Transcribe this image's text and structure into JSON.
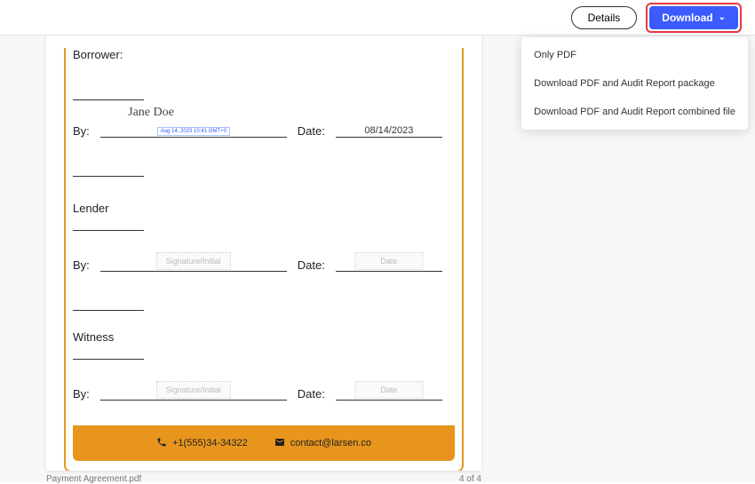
{
  "toolbar": {
    "details_label": "Details",
    "download_label": "Download"
  },
  "download_menu": {
    "items": [
      {
        "label": "Only PDF"
      },
      {
        "label": "Download PDF and Audit Report package"
      },
      {
        "label": "Download PDF and Audit Report combined file"
      }
    ]
  },
  "document": {
    "borrower": {
      "heading": "Borrower:",
      "signed_name": "Jane Doe",
      "by_label": "By:",
      "signature_stamp": "Aug 14, 2023 10:41 GMT+0",
      "date_label": "Date:",
      "date_value": "08/14/2023"
    },
    "lender": {
      "heading": "Lender",
      "by_label": "By:",
      "signature_placeholder": "Signature/Initial",
      "date_label": "Date:",
      "date_placeholder": "Date"
    },
    "witness": {
      "heading": "Witness",
      "by_label": "By:",
      "signature_placeholder": "Signature/Initial",
      "date_label": "Date:",
      "date_placeholder": "Date"
    },
    "footer": {
      "phone": "+1(555)34-34322",
      "email": "contact@larsen.co"
    }
  },
  "viewer": {
    "filename": "Payment Agreement.pdf",
    "page_indicator": "4 of 4"
  }
}
